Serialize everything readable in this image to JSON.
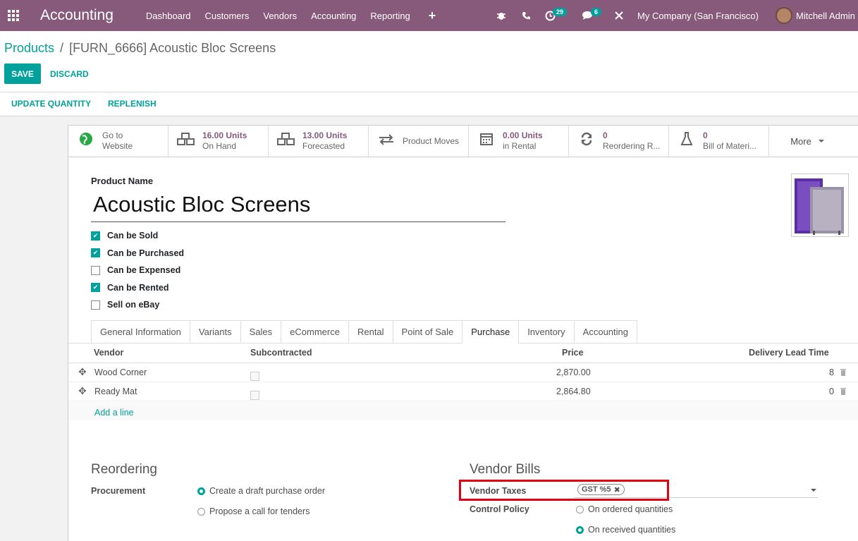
{
  "navbar": {
    "brand": "Accounting",
    "menu": [
      "Dashboard",
      "Customers",
      "Vendors",
      "Accounting",
      "Reporting"
    ],
    "activity_count": "29",
    "message_count": "6",
    "company": "My Company (San Francisco)",
    "user": "Mitchell Admin",
    "color": "#875a7b"
  },
  "breadcrumb": {
    "parent": "Products",
    "current": "[FURN_6666] Acoustic Bloc Screens"
  },
  "actions": {
    "save": "SAVE",
    "discard": "DISCARD"
  },
  "status_buttons": {
    "update_quantity": "UPDATE QUANTITY",
    "replenish": "REPLENISH"
  },
  "smart_buttons": [
    {
      "icon": "globe-icon",
      "line1": "Go to",
      "line2": "Website"
    },
    {
      "icon": "cubes-icon",
      "line1": "16.00 Units",
      "line2": "On Hand"
    },
    {
      "icon": "cubes-icon",
      "line1": "13.00 Units",
      "line2": "Forecasted"
    },
    {
      "icon": "exchange-icon",
      "line1": "Product Moves",
      "line2": ""
    },
    {
      "icon": "calendar-icon",
      "line1": "0.00 Units",
      "line2": "in Rental"
    },
    {
      "icon": "refresh-icon",
      "line1": "0",
      "line2": "Reordering R..."
    },
    {
      "icon": "flask-icon",
      "line1": "0",
      "line2": "Bill of Materi..."
    }
  ],
  "more_label": "More",
  "product": {
    "name_label": "Product Name",
    "name": "Acoustic Bloc Screens",
    "options": [
      {
        "label": "Can be Sold",
        "checked": true
      },
      {
        "label": "Can be Purchased",
        "checked": true
      },
      {
        "label": "Can be Expensed",
        "checked": false
      },
      {
        "label": "Can be Rented",
        "checked": true
      },
      {
        "label": "Sell on eBay",
        "checked": false
      }
    ]
  },
  "tabs": [
    "General Information",
    "Variants",
    "Sales",
    "eCommerce",
    "Rental",
    "Point of Sale",
    "Purchase",
    "Inventory",
    "Accounting"
  ],
  "active_tab": "Purchase",
  "vendor_table": {
    "headers": {
      "vendor": "Vendor",
      "subcontracted": "Subcontracted",
      "price": "Price",
      "lead_time": "Delivery Lead Time"
    },
    "rows": [
      {
        "vendor": "Wood Corner",
        "price": "2,870.00",
        "lead_time": "8"
      },
      {
        "vendor": "Ready Mat",
        "price": "2,864.80",
        "lead_time": "0"
      }
    ],
    "add_line": "Add a line"
  },
  "reordering": {
    "title": "Reordering",
    "procurement_label": "Procurement",
    "options": [
      {
        "label": "Create a draft purchase order",
        "selected": true
      },
      {
        "label": "Propose a call for tenders",
        "selected": false
      }
    ]
  },
  "vendor_bills": {
    "title": "Vendor Bills",
    "taxes_label": "Vendor Taxes",
    "tax_tag": "GST %5",
    "control_label": "Control Policy",
    "options": [
      {
        "label": "On ordered quantities",
        "selected": false
      },
      {
        "label": "On received quantities",
        "selected": true
      }
    ]
  }
}
